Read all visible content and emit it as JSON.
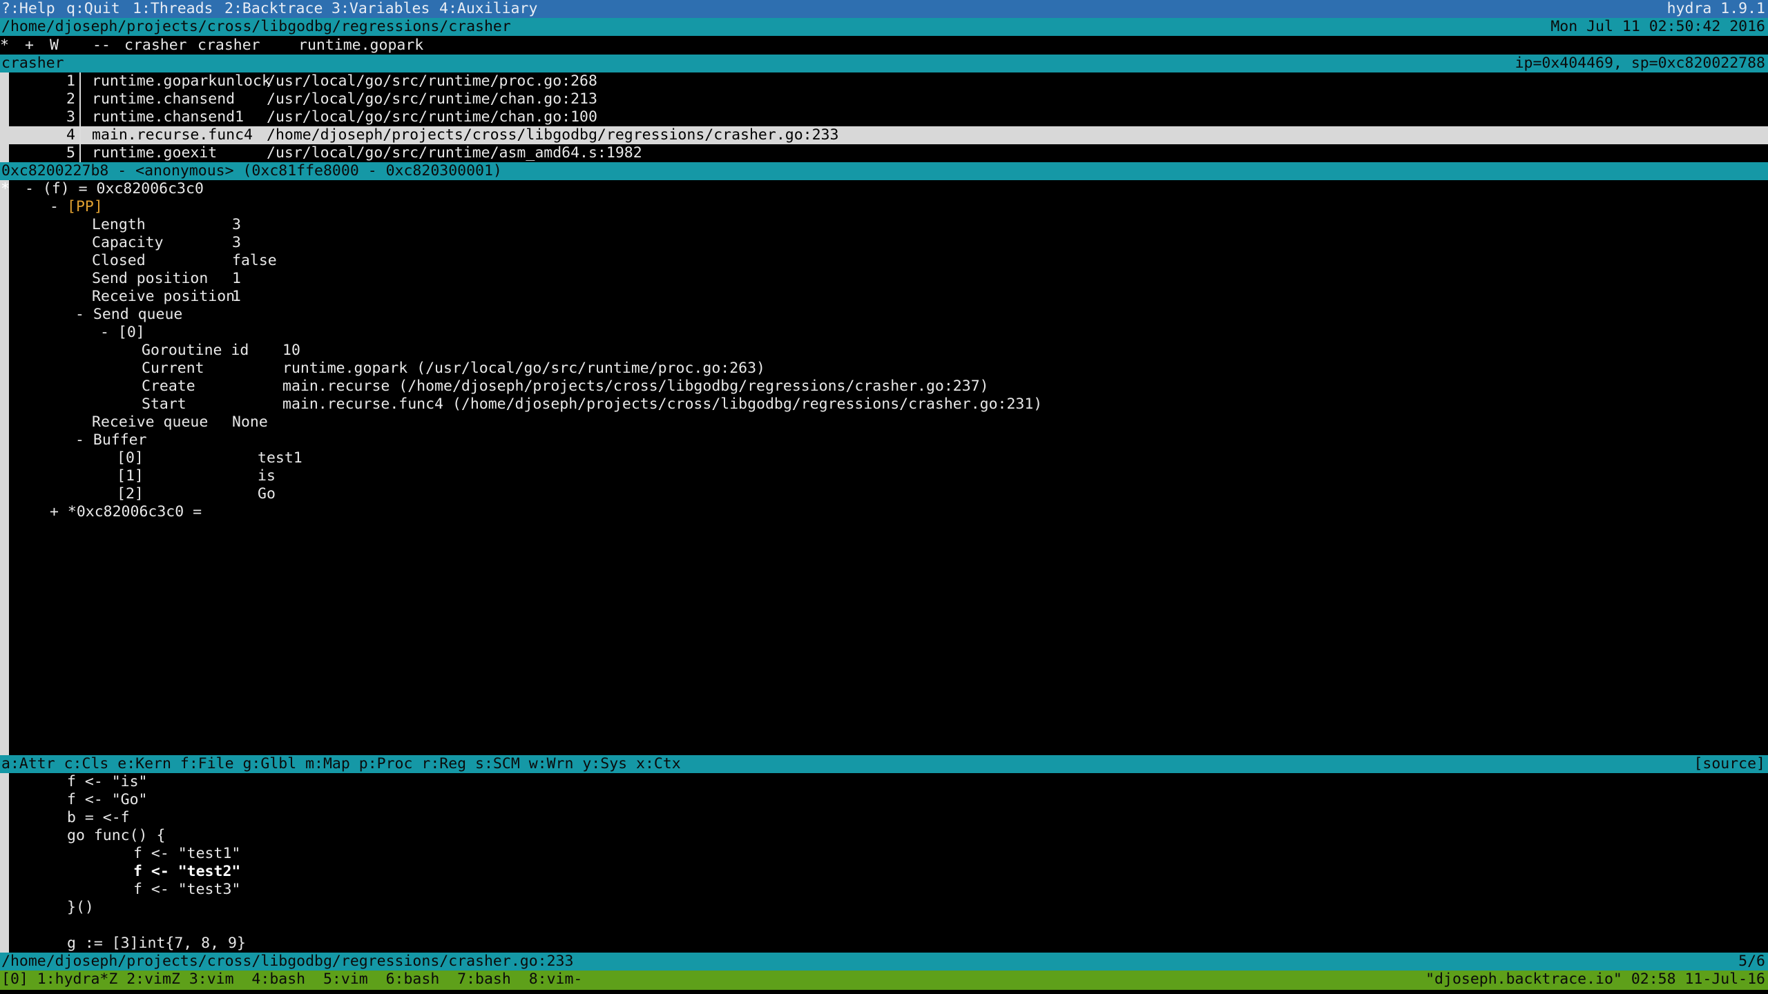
{
  "top_bar": {
    "menu": [
      {
        "key": "?",
        "label": "?:Help"
      },
      {
        "key": "q",
        "label": "q:Quit"
      },
      {
        "key": "1",
        "label": "1:Threads"
      },
      {
        "key": "2",
        "label": "2:Backtrace"
      },
      {
        "key": "3",
        "label": "3:Variables"
      },
      {
        "key": "4",
        "label": "4:Auxiliary"
      }
    ],
    "version": "hydra 1.9.1"
  },
  "path_bar": {
    "path": "/home/djoseph/projects/cross/libgodbg/regressions/crasher",
    "datetime": "Mon Jul 11 02:50:42 2016"
  },
  "thread_row": {
    "marker": "*",
    "plus": "+",
    "state": "W",
    "dashes": "--",
    "name1": "crasher",
    "name2": "crasher",
    "func": "runtime.gopark"
  },
  "thread_header": {
    "name": "crasher",
    "regs": "ip=0x404469, sp=0xc820022788"
  },
  "backtrace": [
    {
      "num": "1",
      "func": "runtime.goparkunlock",
      "loc": "/usr/local/go/src/runtime/proc.go:268"
    },
    {
      "num": "2",
      "func": "runtime.chansend",
      "loc": "/usr/local/go/src/runtime/chan.go:213"
    },
    {
      "num": "3",
      "func": "runtime.chansend1",
      "loc": "/usr/local/go/src/runtime/chan.go:100"
    },
    {
      "num": "4",
      "func": "main.recurse.func4",
      "loc": "/home/djoseph/projects/cross/libgodbg/regressions/crasher.go:233"
    },
    {
      "num": "5",
      "func": "runtime.goexit",
      "loc": "/usr/local/go/src/runtime/asm_amd64.s:1982"
    }
  ],
  "frame_header": "0xc8200227b8 - <anonymous> (0xc81ffe8000 - 0xc820300001)",
  "variables": {
    "root": "- (f) = 0xc82006c3c0",
    "pp": "- [PP]",
    "fields": [
      {
        "k": "Length",
        "v": "3"
      },
      {
        "k": "Capacity",
        "v": "3"
      },
      {
        "k": "Closed",
        "v": "false"
      },
      {
        "k": "Send position",
        "v": "1"
      },
      {
        "k": "Receive position",
        "v": "1"
      }
    ],
    "send_queue": "- Send queue",
    "send_queue_item": "- [0]",
    "goroutine": [
      {
        "k": "Goroutine id",
        "v": "10"
      },
      {
        "k": "Current",
        "v": "runtime.gopark (/usr/local/go/src/runtime/proc.go:263)"
      },
      {
        "k": "Create",
        "v": "main.recurse (/home/djoseph/projects/cross/libgodbg/regressions/crasher.go:237)"
      },
      {
        "k": "Start",
        "v": "main.recurse.func4 (/home/djoseph/projects/cross/libgodbg/regressions/crasher.go:231)"
      }
    ],
    "receive_queue": {
      "k": "Receive queue",
      "v": "None"
    },
    "buffer": "- Buffer",
    "buffer_items": [
      {
        "k": "[0]",
        "v": "test1"
      },
      {
        "k": "[1]",
        "v": "is"
      },
      {
        "k": "[2]",
        "v": "Go"
      }
    ],
    "deref": "+ *0xc82006c3c0 ="
  },
  "aux_bar": {
    "items": "a:Attr c:Cls e:Kern f:File g:Glbl m:Map p:Proc r:Reg s:SCM w:Wrn y:Sys x:Ctx",
    "source_label": "[source]"
  },
  "source_lines": [
    "f <- \"is\"",
    "f <- \"Go\"",
    "b = <-f",
    "go func() {",
    "f <- \"test1\"",
    "f <- \"test2\"",
    "f <- \"test3\"",
    "}()",
    "",
    "g := [3]int{7, 8, 9}"
  ],
  "source_status": {
    "path": "/home/djoseph/projects/cross/libgodbg/regressions/crasher.go:233",
    "pos": "5/6"
  },
  "tmux": {
    "windows": "[0] 1:hydra*Z 2:vimZ 3:vim  4:bash  5:vim  6:bash  7:bash  8:vim-",
    "host": "\"djoseph.backtrace.io\" 02:58 11-Jul-16"
  }
}
